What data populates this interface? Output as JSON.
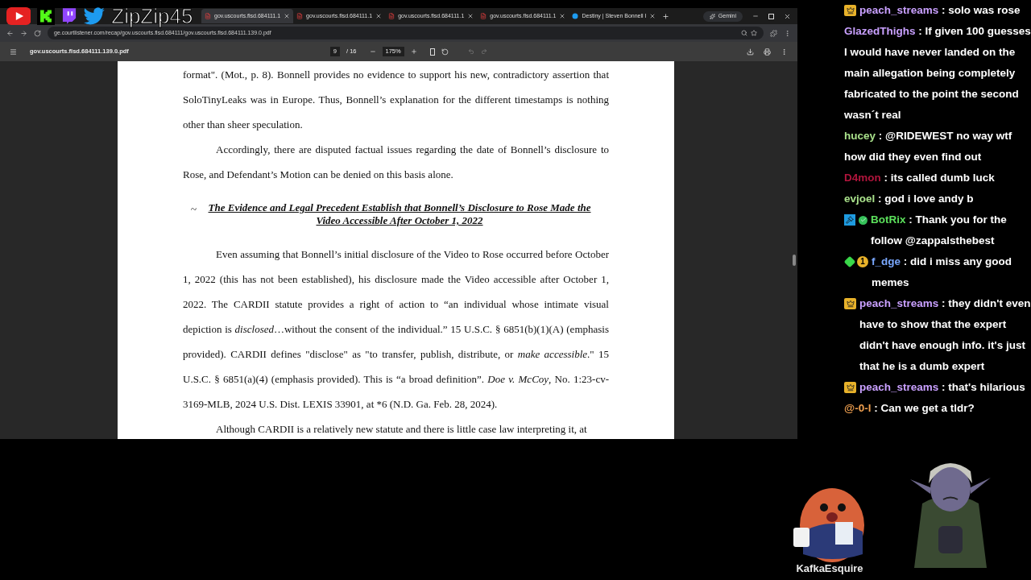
{
  "overlay": {
    "streamer_name": "ZipZip45"
  },
  "browser": {
    "tabs": [
      {
        "title": "gov.uscourts.flsd.684111.1",
        "selected": true
      },
      {
        "title": "gov.uscourts.flsd.684111.1",
        "selected": false
      },
      {
        "title": "gov.uscourts.flsd.684111.1",
        "selected": false
      },
      {
        "title": "gov.uscourts.flsd.684111.1",
        "selected": false
      },
      {
        "title": "Destiny | Steven Bonnell I",
        "selected": false,
        "kind": "twitter"
      }
    ],
    "gemini_label": "Gemini",
    "address": "ge.courtlistener.com/recap/gov.uscourts.flsd.684111/gov.uscourts.flsd.684111.139.0.pdf"
  },
  "pdf_toolbar": {
    "filename": "gov.uscourts.flsd.684111.139.0.pdf",
    "page": "9",
    "page_count": "/ 16",
    "zoom": "175%"
  },
  "document": {
    "blocks": [
      {
        "kind": "paragraph",
        "indent": false,
        "text": "format\". (Mot., p. 8). Bonnell provides no evidence to support his new, contradictory assertion that SoloTinyLeaks was in Europe. Thus, Bonnell’s explanation for the different timestamps is nothing other than sheer speculation."
      },
      {
        "kind": "paragraph",
        "indent": true,
        "text": "Accordingly, there are disputed factual issues regarding the date of Bonnell’s disclosure to Rose, and Defendant’s Motion can be denied on this basis alone."
      },
      {
        "kind": "heading",
        "marker": "~",
        "text": "The Evidence and Legal Precedent Establish that Bonnell’s Disclosure to Rose Made the Video Accessible After October 1, 2022"
      },
      {
        "kind": "paragraph",
        "indent": true,
        "text": "Even assuming that Bonnell’s initial disclosure of the Video to Rose occurred before October 1, 2022 (this has not been established), his disclosure made the Video accessible after October 1, 2022.  The CARDII statute provides a right of action to “an individual whose intimate visual depiction is *disclosed*…without the consent of the individual.” 15 U.S.C. § 6851(b)(1)(A) (emphasis provided). CARDII defines \"disclose\" as \"to transfer, publish, distribute, or *make accessible*.\" 15 U.S.C. § 6851(a)(4) (emphasis provided). This is “a broad definition”. *Doe v. McCoy*, No. 1:23-cv-3169-MLB, 2024 U.S. Dist. LEXIS 33901, at *6 (N.D. Ga. Feb. 28, 2024)."
      },
      {
        "kind": "paragraph",
        "indent": true,
        "text": "Although CARDII is a relatively new statute and there is little case law interpreting it, at"
      }
    ]
  },
  "chat": [
    {
      "user": "peach_streams",
      "color": "#c9a0ff",
      "badges": [
        {
          "kind": "crown"
        }
      ],
      "message": ": solo was rose"
    },
    {
      "user": "GlazedThighs",
      "color": "#c9a0ff",
      "message": ": If given 100 guesses I would have never landed on the main allegation being completely fabricated to the point the second wasn´t real"
    },
    {
      "user": "hucey",
      "color": "#a8e08a",
      "message": ": @RIDEWEST no way wtf how did they even find out"
    },
    {
      "user": "D4mon",
      "color": "#b0153c",
      "message": ": its called dumb luck"
    },
    {
      "user": "evjoel",
      "color": "#a8e08a",
      "message": ": god i love andy b"
    },
    {
      "user": "BotRix",
      "color": "#5be05b",
      "badges": [
        {
          "kind": "mod"
        },
        {
          "kind": "verified"
        }
      ],
      "message": ": Thank you for the follow @zappalsthebest"
    },
    {
      "user": "f_dge",
      "color": "#7aa8ff",
      "badges": [
        {
          "kind": "gem"
        },
        {
          "kind": "count",
          "label": "1"
        }
      ],
      "message": ": did i miss any good memes"
    },
    {
      "user": "peach_streams",
      "color": "#c9a0ff",
      "badges": [
        {
          "kind": "crown"
        }
      ],
      "message": ": they didn't even have to show that the expert didn't have enough info. it's just that he is a dumb expert"
    },
    {
      "user": "peach_streams",
      "color": "#c9a0ff",
      "badges": [
        {
          "kind": "crown"
        }
      ],
      "message": ": that's hilarious"
    },
    {
      "user": "@-0-l",
      "color": "#f0a050",
      "message": ": Can we get a tldr?"
    }
  ],
  "avatars": {
    "label": "KafkaEsquire"
  }
}
